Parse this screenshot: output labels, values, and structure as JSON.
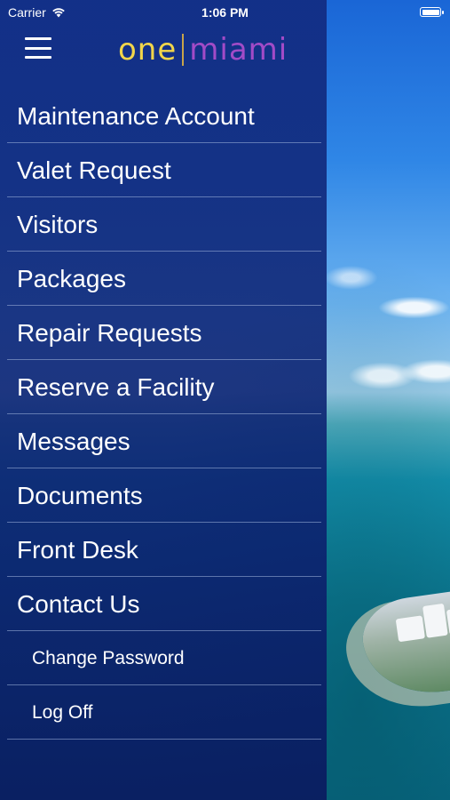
{
  "status_bar": {
    "carrier": "Carrier",
    "time": "1:06 PM",
    "wifi_icon": "wifi-icon",
    "battery_icon": "battery-icon"
  },
  "header": {
    "menu_icon": "hamburger-icon",
    "logo": {
      "left": "one",
      "right": "miami",
      "left_color": "#f1d54a",
      "right_color": "#a24bc7"
    }
  },
  "menu": {
    "items": [
      {
        "label": "Maintenance Account"
      },
      {
        "label": "Valet Request"
      },
      {
        "label": "Visitors"
      },
      {
        "label": "Packages"
      },
      {
        "label": "Repair Requests"
      },
      {
        "label": "Reserve a Facility"
      },
      {
        "label": "Messages"
      },
      {
        "label": "Documents"
      },
      {
        "label": "Front Desk"
      },
      {
        "label": "Contact Us"
      }
    ],
    "sub_items": [
      {
        "label": "Change Password"
      },
      {
        "label": "Log Off"
      }
    ]
  },
  "colors": {
    "drawer_background": "#122c82",
    "divider": "#a0b4dc",
    "text": "#ffffff"
  }
}
